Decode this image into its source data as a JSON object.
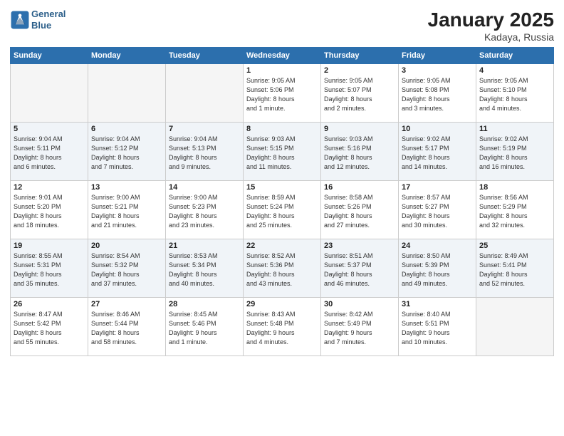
{
  "header": {
    "logo_line1": "General",
    "logo_line2": "Blue",
    "title": "January 2025",
    "location": "Kadaya, Russia"
  },
  "days_of_week": [
    "Sunday",
    "Monday",
    "Tuesday",
    "Wednesday",
    "Thursday",
    "Friday",
    "Saturday"
  ],
  "weeks": [
    [
      {
        "day": "",
        "info": ""
      },
      {
        "day": "",
        "info": ""
      },
      {
        "day": "",
        "info": ""
      },
      {
        "day": "1",
        "info": "Sunrise: 9:05 AM\nSunset: 5:06 PM\nDaylight: 8 hours\nand 1 minute."
      },
      {
        "day": "2",
        "info": "Sunrise: 9:05 AM\nSunset: 5:07 PM\nDaylight: 8 hours\nand 2 minutes."
      },
      {
        "day": "3",
        "info": "Sunrise: 9:05 AM\nSunset: 5:08 PM\nDaylight: 8 hours\nand 3 minutes."
      },
      {
        "day": "4",
        "info": "Sunrise: 9:05 AM\nSunset: 5:10 PM\nDaylight: 8 hours\nand 4 minutes."
      }
    ],
    [
      {
        "day": "5",
        "info": "Sunrise: 9:04 AM\nSunset: 5:11 PM\nDaylight: 8 hours\nand 6 minutes."
      },
      {
        "day": "6",
        "info": "Sunrise: 9:04 AM\nSunset: 5:12 PM\nDaylight: 8 hours\nand 7 minutes."
      },
      {
        "day": "7",
        "info": "Sunrise: 9:04 AM\nSunset: 5:13 PM\nDaylight: 8 hours\nand 9 minutes."
      },
      {
        "day": "8",
        "info": "Sunrise: 9:03 AM\nSunset: 5:15 PM\nDaylight: 8 hours\nand 11 minutes."
      },
      {
        "day": "9",
        "info": "Sunrise: 9:03 AM\nSunset: 5:16 PM\nDaylight: 8 hours\nand 12 minutes."
      },
      {
        "day": "10",
        "info": "Sunrise: 9:02 AM\nSunset: 5:17 PM\nDaylight: 8 hours\nand 14 minutes."
      },
      {
        "day": "11",
        "info": "Sunrise: 9:02 AM\nSunset: 5:19 PM\nDaylight: 8 hours\nand 16 minutes."
      }
    ],
    [
      {
        "day": "12",
        "info": "Sunrise: 9:01 AM\nSunset: 5:20 PM\nDaylight: 8 hours\nand 18 minutes."
      },
      {
        "day": "13",
        "info": "Sunrise: 9:00 AM\nSunset: 5:21 PM\nDaylight: 8 hours\nand 21 minutes."
      },
      {
        "day": "14",
        "info": "Sunrise: 9:00 AM\nSunset: 5:23 PM\nDaylight: 8 hours\nand 23 minutes."
      },
      {
        "day": "15",
        "info": "Sunrise: 8:59 AM\nSunset: 5:24 PM\nDaylight: 8 hours\nand 25 minutes."
      },
      {
        "day": "16",
        "info": "Sunrise: 8:58 AM\nSunset: 5:26 PM\nDaylight: 8 hours\nand 27 minutes."
      },
      {
        "day": "17",
        "info": "Sunrise: 8:57 AM\nSunset: 5:27 PM\nDaylight: 8 hours\nand 30 minutes."
      },
      {
        "day": "18",
        "info": "Sunrise: 8:56 AM\nSunset: 5:29 PM\nDaylight: 8 hours\nand 32 minutes."
      }
    ],
    [
      {
        "day": "19",
        "info": "Sunrise: 8:55 AM\nSunset: 5:31 PM\nDaylight: 8 hours\nand 35 minutes."
      },
      {
        "day": "20",
        "info": "Sunrise: 8:54 AM\nSunset: 5:32 PM\nDaylight: 8 hours\nand 37 minutes."
      },
      {
        "day": "21",
        "info": "Sunrise: 8:53 AM\nSunset: 5:34 PM\nDaylight: 8 hours\nand 40 minutes."
      },
      {
        "day": "22",
        "info": "Sunrise: 8:52 AM\nSunset: 5:36 PM\nDaylight: 8 hours\nand 43 minutes."
      },
      {
        "day": "23",
        "info": "Sunrise: 8:51 AM\nSunset: 5:37 PM\nDaylight: 8 hours\nand 46 minutes."
      },
      {
        "day": "24",
        "info": "Sunrise: 8:50 AM\nSunset: 5:39 PM\nDaylight: 8 hours\nand 49 minutes."
      },
      {
        "day": "25",
        "info": "Sunrise: 8:49 AM\nSunset: 5:41 PM\nDaylight: 8 hours\nand 52 minutes."
      }
    ],
    [
      {
        "day": "26",
        "info": "Sunrise: 8:47 AM\nSunset: 5:42 PM\nDaylight: 8 hours\nand 55 minutes."
      },
      {
        "day": "27",
        "info": "Sunrise: 8:46 AM\nSunset: 5:44 PM\nDaylight: 8 hours\nand 58 minutes."
      },
      {
        "day": "28",
        "info": "Sunrise: 8:45 AM\nSunset: 5:46 PM\nDaylight: 9 hours\nand 1 minute."
      },
      {
        "day": "29",
        "info": "Sunrise: 8:43 AM\nSunset: 5:48 PM\nDaylight: 9 hours\nand 4 minutes."
      },
      {
        "day": "30",
        "info": "Sunrise: 8:42 AM\nSunset: 5:49 PM\nDaylight: 9 hours\nand 7 minutes."
      },
      {
        "day": "31",
        "info": "Sunrise: 8:40 AM\nSunset: 5:51 PM\nDaylight: 9 hours\nand 10 minutes."
      },
      {
        "day": "",
        "info": ""
      }
    ]
  ]
}
